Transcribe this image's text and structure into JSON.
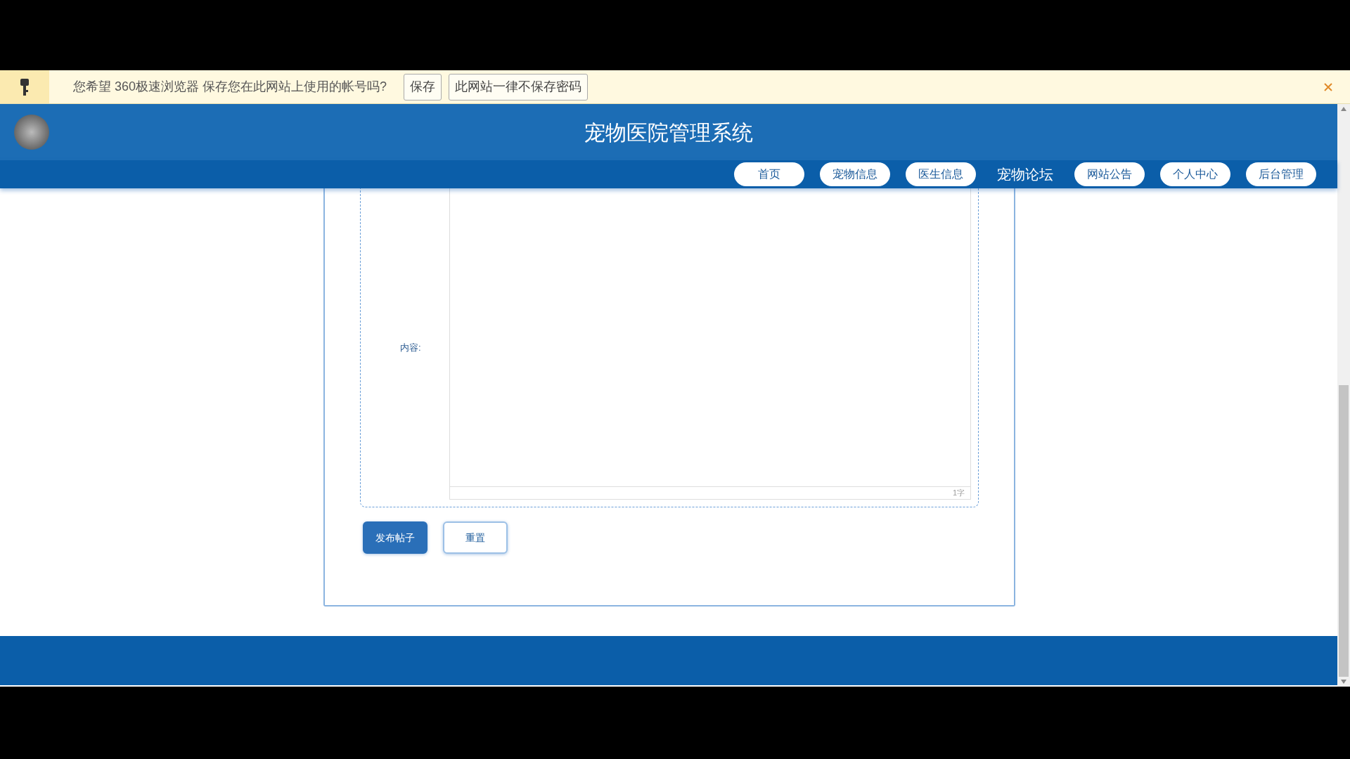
{
  "password_bar": {
    "message": "您希望 360极速浏览器 保存您在此网站上使用的帐号吗?",
    "buttons": [
      "保存",
      "此网站一律不保存密码"
    ]
  },
  "header": {
    "title": "宠物医院管理系统"
  },
  "nav": [
    {
      "label": "首页",
      "selected": false
    },
    {
      "label": "宠物信息",
      "selected": false
    },
    {
      "label": "医生信息",
      "selected": false
    },
    {
      "label": "宠物论坛",
      "selected": true
    },
    {
      "label": "网站公告",
      "selected": false
    },
    {
      "label": "个人中心",
      "selected": false
    },
    {
      "label": "后台管理",
      "selected": false
    }
  ],
  "form": {
    "content_label": "内容:",
    "word_count": "1字",
    "buttons": [
      {
        "label": "发布帖子",
        "kind": "primary"
      },
      {
        "label": "重置",
        "kind": "secondary"
      }
    ]
  }
}
